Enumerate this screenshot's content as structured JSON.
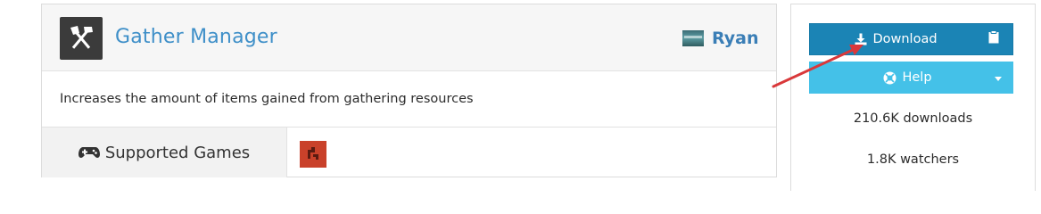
{
  "plugin": {
    "title": "Gather Manager",
    "author": "Ryan",
    "description": "Increases the amount of items gained from gathering resources",
    "supported_games_label": "Supported Games",
    "icons": {
      "plugin": "crossed-tools-icon",
      "gamepad": "gamepad-icon",
      "game": "rust-game-icon"
    }
  },
  "sidebar": {
    "download_label": "Download",
    "help_label": "Help",
    "downloads_count": "210.6K downloads",
    "watchers_count": "1.8K watchers",
    "icons": {
      "download": "download-icon",
      "clipboard": "clipboard-icon",
      "help": "lifebuoy-icon",
      "caret": "caret-down-icon"
    }
  },
  "colors": {
    "title": "#3e8fc8",
    "download_button": "#1b84b5",
    "help_button": "#44c1e8",
    "annotation_arrow": "#d9383a",
    "rust_icon_bg": "#c9412a"
  }
}
